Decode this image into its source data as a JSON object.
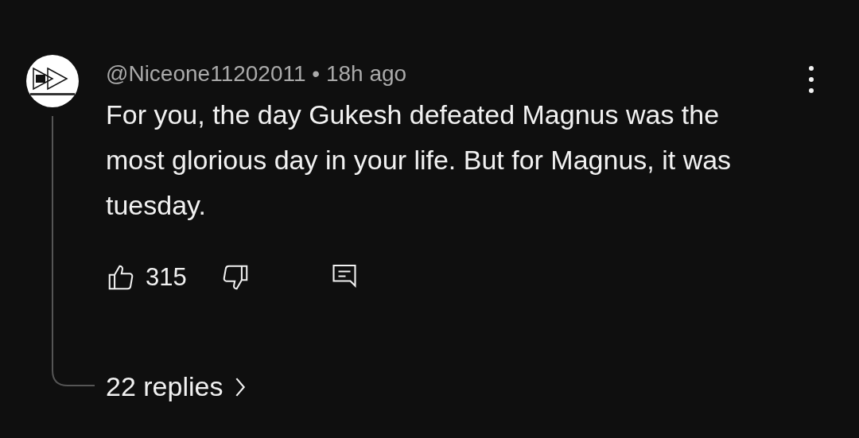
{
  "comment": {
    "author": "@Niceone11202011",
    "separator": "•",
    "time": "18h ago",
    "text": "For you, the day Gukesh defeated Magnus was the most glorious day in your life. But for Magnus, it was tuesday.",
    "likes": "315",
    "replies": "22 replies"
  }
}
